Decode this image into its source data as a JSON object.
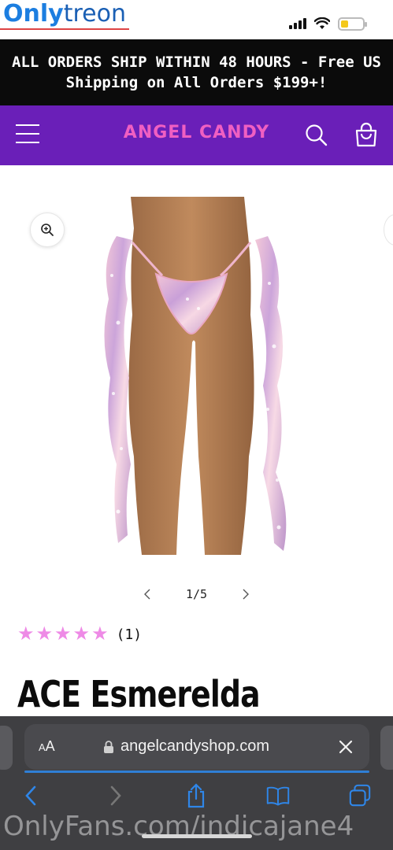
{
  "watermark": {
    "brand_a": "Only",
    "brand_b": "treon",
    "footer": "OnlyFans.com/indicajane4"
  },
  "status_bar": {
    "battery_level": 0.35,
    "battery_color": "#f4c81a"
  },
  "announcement": {
    "text": "ALL ORDERS SHIP WITHIN 48 HOURS - Free US Shipping on All Orders $199+!"
  },
  "header": {
    "brand": "ANGEL CANDY",
    "brand_color": "#f05fc2",
    "background": "#6a1fb8",
    "menu_icon": "hamburger-icon",
    "search_icon": "search-icon",
    "cart_icon": "bag-icon"
  },
  "media": {
    "zoom_icon": "zoom-in-icon",
    "slider": {
      "current": 1,
      "total": 5,
      "label": "1/5"
    }
  },
  "rating": {
    "stars": 5,
    "count_label": "(1)",
    "star_color": "#ee8ae6"
  },
  "product": {
    "title": "ACE Esmerelda"
  },
  "safari": {
    "aa_label": "AA",
    "url": "angelcandyshop.com",
    "toolbar": [
      "back-icon",
      "forward-icon",
      "share-icon",
      "bookmarks-icon",
      "tabs-icon"
    ]
  }
}
